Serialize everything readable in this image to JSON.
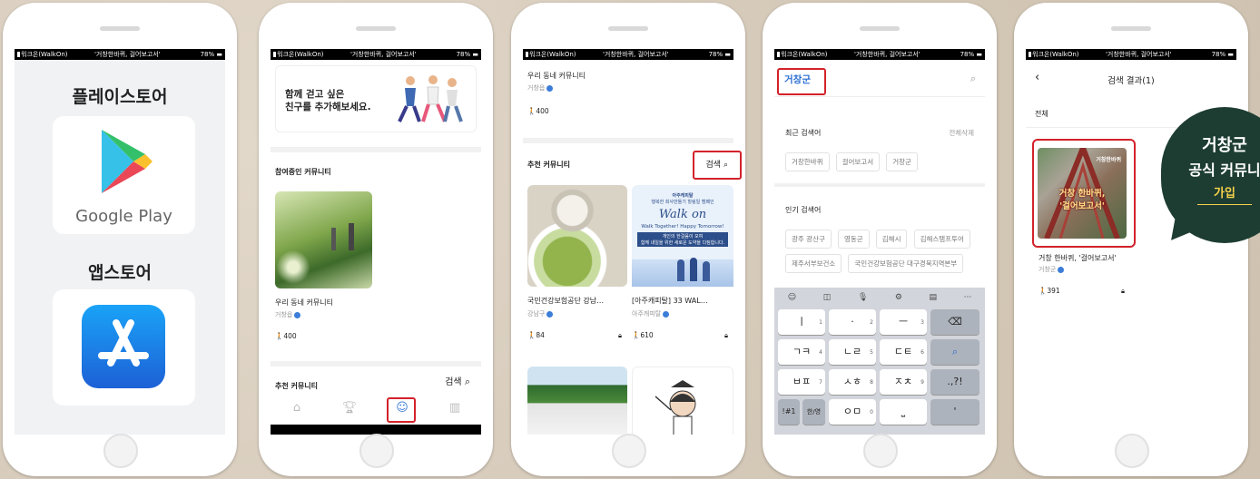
{
  "status": {
    "carrier": "워크온(WalkOn)",
    "title": "'거창한바퀴, 걸어보고서'",
    "battery": "78%"
  },
  "phone1": {
    "play_label": "플레이스토어",
    "google_play": "Google Play",
    "app_label": "앱스토어"
  },
  "phone2": {
    "banner_line1": "함께 걷고 싶은",
    "banner_line2": "친구를 추가해보세요.",
    "joined_header": "참여중인 커뮤니티",
    "community_name": "우리 동네 커뮤니티",
    "community_owner": "거창읍",
    "community_steps": "400",
    "recommended_header": "추천 커뮤니티",
    "search_label": "검색",
    "tabs": [
      "home-icon",
      "trophy-icon",
      "community-icon",
      "map-icon"
    ]
  },
  "phone3": {
    "top_name": "우리 동네 커뮤니티",
    "top_owner": "거창읍",
    "top_steps": "400",
    "recommended_header": "추천 커뮤니티",
    "search_label": "검색",
    "cards": [
      {
        "title": "국민건강보험공단 강남…",
        "owner": "강남구",
        "steps": "84"
      },
      {
        "title": "[아주캐피탈] 33 WAL…",
        "owner": "아주캐피탈",
        "steps": "610"
      }
    ],
    "walkon_banner": {
      "line1": "아주캐피탈",
      "line2": "행복한 회사만들기 힐링일 캠페인",
      "brand": "Walk on",
      "line3": "Walk Together! Happy Tomorrow!",
      "line4": "개인의 한걸음이 모여",
      "line5": "함께 내일을 위한 새로운 도약을 다짐합니다."
    }
  },
  "phone4": {
    "query": "거창군",
    "recent_header": "최근 검색어",
    "clear_all": "전체삭제",
    "recent": [
      "거창한바퀴",
      "걸어보고서",
      "거창군"
    ],
    "popular_header": "인기 검색어",
    "popular": [
      "광주 광산구",
      "영동군",
      "김해시",
      "김해스탬프투어",
      "제주서부보건소",
      "국민건강보험공단 대구경북지역본부"
    ],
    "keys": [
      [
        "ㅣ",
        "1"
      ],
      [
        "·",
        "2"
      ],
      [
        "ㅡ",
        "3"
      ],
      [
        "ㄱㅋ",
        "4"
      ],
      [
        "ㄴㄹ",
        "5"
      ],
      [
        "ㄷㅌ",
        "6"
      ],
      [
        "ㅂㅍ",
        "7"
      ],
      [
        "ㅅㅎ",
        "8"
      ],
      [
        "ㅈㅊ",
        "9"
      ],
      [
        "!#1",
        ""
      ],
      [
        "한/영",
        ""
      ],
      [
        "ㅇㅁ",
        "0"
      ]
    ],
    "punct_key": ".,?!",
    "apostrophe_key": "'"
  },
  "phone5": {
    "page_title": "검색 결과(1)",
    "all_label": "전체",
    "result_name": "거창 한바퀴, '걸어보고서'",
    "result_owner": "거창군",
    "result_steps": "391",
    "thumb_text1": "거창 한바퀴,",
    "thumb_text2": "'걸어보고서'",
    "thumb_logo": "거창한바퀴"
  },
  "callout": {
    "line1": "거창군",
    "line2": "공식 커뮤니",
    "line3": "가입"
  }
}
